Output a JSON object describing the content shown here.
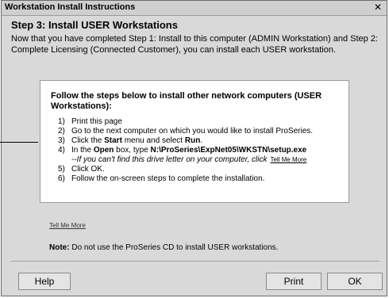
{
  "window": {
    "title": "Workstation Install Instructions",
    "close_glyph": "✕"
  },
  "step_title": "Step 3: Install USER Workstations",
  "intro": "Now that you have completed Step 1: Install to this computer (ADMIN Workstation) and Step 2: Complete Licensing (Connected Customer), you can install each USER workstation.",
  "panel": {
    "heading": "Follow the steps below to install other network computers (USER Workstations):",
    "steps": [
      {
        "num": "1)",
        "text": "Print this page"
      },
      {
        "num": "2)",
        "text": "Go to the next computer on which you would like to install ProSeries."
      },
      {
        "num": "3)",
        "pre": "Click the ",
        "bold1": "Start",
        "mid": " menu and select ",
        "bold2": "Run",
        "post": "."
      },
      {
        "num": "4)",
        "pre": "In the ",
        "bold1": "Open",
        "mid": " box, type ",
        "bold2": "N:\\ProSeries\\ExpNet05\\WKSTN\\setup.exe"
      },
      {
        "sub": "--If you can't find this drive letter on your computer, click",
        "link": "Tell Me More"
      },
      {
        "num": "5)",
        "text": "Click OK."
      },
      {
        "num": "6)",
        "text": "Follow the on-screen steps to complete the installation."
      }
    ]
  },
  "footer_link": "Tell Me More",
  "note": {
    "label": "Note:",
    "text": "Do not use the ProSeries CD to install USER workstations."
  },
  "buttons": {
    "help": "Help",
    "print": "Print",
    "ok": "OK"
  }
}
